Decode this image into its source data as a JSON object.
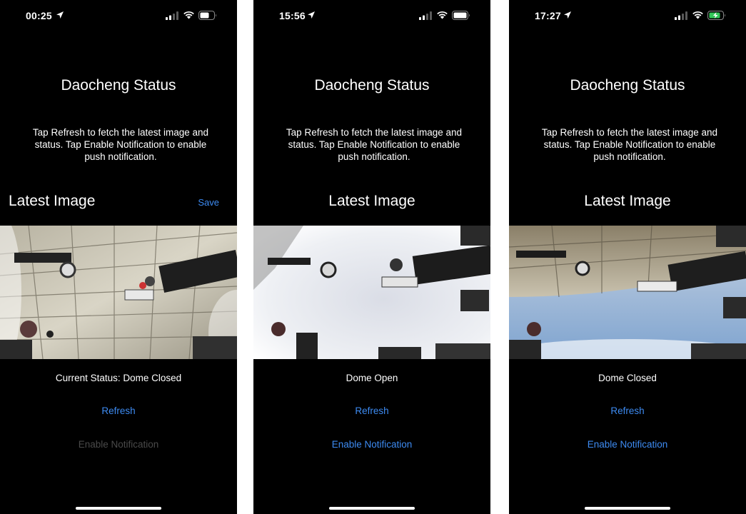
{
  "screens": [
    {
      "time": "00:25",
      "title": "Daocheng Status",
      "instructions": "Tap Refresh to fetch the latest image and status. Tap Enable Notification to enable push notification.",
      "latest_image_label": "Latest Image",
      "save_label": "Save",
      "status_text": "Current Status: Dome Closed",
      "refresh_label": "Refresh",
      "notification_label": "Enable Notification",
      "notification_enabled": false,
      "battery": "normal",
      "sky": "closed"
    },
    {
      "time": "15:56",
      "title": "Daocheng Status",
      "instructions": "Tap Refresh to fetch the latest image and status. Tap Enable Notification to enable push notification.",
      "latest_image_label": "Latest Image",
      "status_text": "Dome Open",
      "refresh_label": "Refresh",
      "notification_label": "Enable Notification",
      "notification_enabled": true,
      "battery": "full",
      "sky": "open-bright"
    },
    {
      "time": "17:27",
      "title": "Daocheng Status",
      "instructions": "Tap Refresh to fetch the latest image and status. Tap Enable Notification to enable push notification.",
      "latest_image_label": "Latest Image",
      "status_text": "Dome Closed",
      "refresh_label": "Refresh",
      "notification_label": "Enable Notification",
      "notification_enabled": true,
      "battery": "charging",
      "sky": "open-blue"
    }
  ],
  "colors": {
    "accent": "#3d8bf2",
    "disabled": "#4a4a4a",
    "background": "#000000",
    "charging": "#34c759"
  }
}
